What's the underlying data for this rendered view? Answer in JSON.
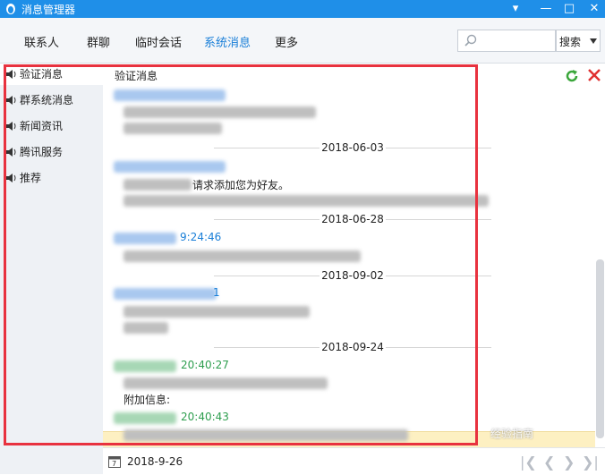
{
  "window": {
    "title": "消息管理器"
  },
  "tabs": [
    {
      "label": "联系人"
    },
    {
      "label": "群聊"
    },
    {
      "label": "临时会话"
    },
    {
      "label": "系统消息"
    },
    {
      "label": "更多"
    }
  ],
  "search": {
    "button_label": "搜索"
  },
  "sidebar": {
    "items": [
      {
        "label": "验证消息"
      },
      {
        "label": "群系统消息"
      },
      {
        "label": "新闻资讯"
      },
      {
        "label": "腾讯服务"
      },
      {
        "label": "推荐"
      }
    ]
  },
  "content": {
    "title": "验证消息",
    "dates": [
      "2018-06-03",
      "2018-06-28",
      "2018-09-02",
      "2018-09-24"
    ],
    "messages": [
      {
        "sender_time": ""
      },
      {
        "sender_time": "",
        "text": "请求添加您为好友。"
      },
      {
        "sender_time": "9:24:46"
      },
      {
        "sender_time": "1"
      },
      {
        "sender_time": "20:40:27",
        "text": "附加信息:"
      },
      {
        "sender_time": "20:40:43"
      }
    ]
  },
  "footer": {
    "date": "2018-9-26"
  },
  "watermark": "经验指南",
  "colors": {
    "accent": "#1a7fd8",
    "green_sender": "#2e9e4f",
    "highlight": "#fdf0c2",
    "red_frame": "#e8323f"
  }
}
